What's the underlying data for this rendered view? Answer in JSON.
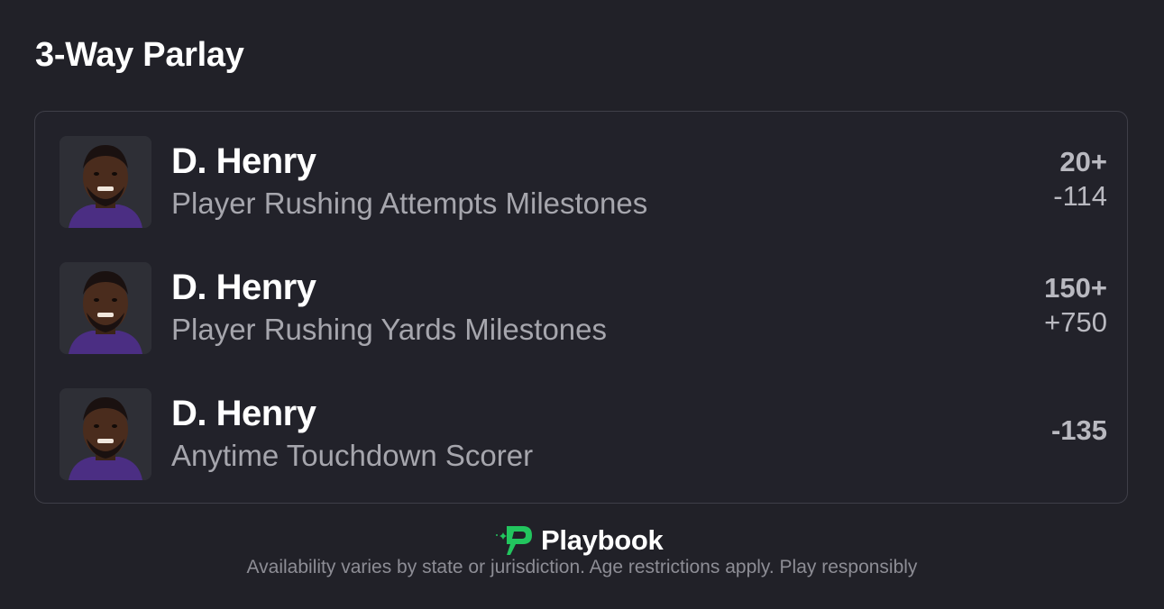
{
  "header": {
    "title": "3-Way Parlay"
  },
  "legs": [
    {
      "player": "D. Henry",
      "market": "Player Rushing Attempts Milestones",
      "line": "20+",
      "price": "-114"
    },
    {
      "player": "D. Henry",
      "market": "Player Rushing Yards Milestones",
      "line": "150+",
      "price": "+750"
    },
    {
      "player": "D. Henry",
      "market": "Anytime Touchdown Scorer",
      "line": "",
      "price": "-135"
    }
  ],
  "footer": {
    "brand": "Playbook",
    "logo_icon": "playbook-logo-icon",
    "disclaimer": "Availability varies by state or jurisdiction. Age restrictions apply. Play responsibly"
  },
  "colors": {
    "background": "#212128",
    "brand_green": "#22c55e",
    "jersey_purple": "#4b2e83"
  }
}
